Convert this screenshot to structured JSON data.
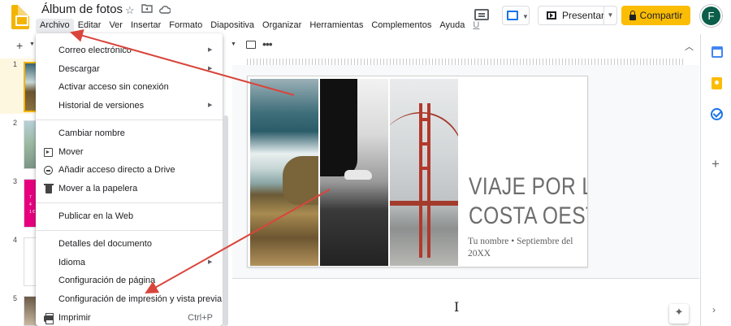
{
  "header": {
    "doc_title": "Álbum de fotos",
    "star_icon": "star-icon",
    "folder_icon": "folder-icon",
    "cloud_icon": "cloud-icon",
    "present_label": "Presentar",
    "share_label": "Compartir",
    "avatar_letter": "F"
  },
  "menubar": [
    "Archivo",
    "Editar",
    "Ver",
    "Insertar",
    "Formato",
    "Diapositiva",
    "Organizar",
    "Herramientas",
    "Complementos",
    "Ayuda",
    "Ú"
  ],
  "filmstrip": {
    "slide_numbers": [
      "1",
      "2",
      "3",
      "4",
      "5"
    ],
    "thumb3_lines": [
      "7",
      "4",
      "1 €"
    ]
  },
  "file_menu": {
    "items": [
      {
        "label": "Correo electrónico",
        "submenu": true
      },
      {
        "label": "Descargar",
        "submenu": true
      },
      {
        "label": "Activar acceso sin conexión",
        "submenu": false
      },
      {
        "label": "Historial de versiones",
        "submenu": true
      },
      {
        "label": "Cambiar nombre",
        "submenu": false
      },
      {
        "label": "Mover",
        "submenu": false,
        "icon": "move-folder-icon"
      },
      {
        "label": "Añadir acceso directo a Drive",
        "submenu": false,
        "icon": "drive-shortcut-icon"
      },
      {
        "label": "Mover a la papelera",
        "submenu": false,
        "icon": "trash-icon"
      },
      {
        "label": "Publicar en la Web",
        "submenu": false
      },
      {
        "label": "Detalles del documento",
        "submenu": false
      },
      {
        "label": "Idioma",
        "submenu": true
      },
      {
        "label": "Configuración de página",
        "submenu": false
      },
      {
        "label": "Configuración de impresión y vista previa",
        "submenu": false
      },
      {
        "label": "Imprimir",
        "submenu": false,
        "icon": "print-icon",
        "shortcut": "Ctrl+P"
      }
    ]
  },
  "slide": {
    "title_line1": "VIAJE POR LA",
    "title_line2": "COSTA OESTE",
    "subtitle_line1": "Tu nombre • Septiembre del",
    "subtitle_line2": "20XX"
  },
  "colors": {
    "share_button": "#fbbc04",
    "accent_blue": "#1a73e8",
    "annotation_arrow": "#d9453b",
    "selected_thumb_border": "#f4b400"
  }
}
